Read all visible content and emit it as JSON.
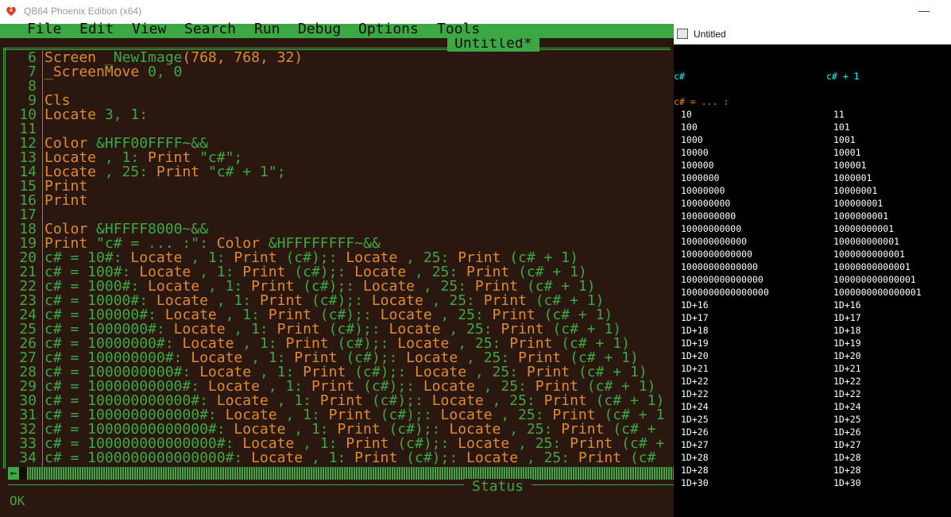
{
  "window": {
    "title": "QB64 Phoenix Edition (x64)",
    "minimize_glyph": "—"
  },
  "menu": [
    "File",
    "Edit",
    "View",
    "Search",
    "Run",
    "Debug",
    "Options",
    "Tools"
  ],
  "editor": {
    "tab_title": "Untitled*",
    "line_numbers": [
      "6",
      "7",
      "8",
      "9",
      "10",
      "11",
      "12",
      "13",
      "14",
      "15",
      "16",
      "17",
      "18",
      "19",
      "20",
      "21",
      "22",
      "23",
      "24",
      "25",
      "26",
      "27",
      "28",
      "29",
      "30",
      "31",
      "32",
      "33",
      "34"
    ],
    "lines": [
      [
        [
          "kw",
          "Screen "
        ],
        [
          "tx",
          "_NewImage"
        ],
        [
          "kw",
          "(768, 768, 32)"
        ]
      ],
      [
        [
          "kw",
          "_ScreenMove "
        ],
        [
          "tx",
          "0, 0"
        ]
      ],
      [],
      [
        [
          "kw",
          "Cls"
        ]
      ],
      [
        [
          "kw",
          "Locate "
        ],
        [
          "tx",
          "3, 1:"
        ]
      ],
      [],
      [
        [
          "kw",
          "Color "
        ],
        [
          "tx",
          "&HFF00FFFF~&&"
        ]
      ],
      [
        [
          "kw",
          "Locate "
        ],
        [
          "tx",
          ", 1: "
        ],
        [
          "kw",
          "Print "
        ],
        [
          "tx",
          "\"c#\";"
        ]
      ],
      [
        [
          "kw",
          "Locate "
        ],
        [
          "tx",
          ", 25: "
        ],
        [
          "kw",
          "Print "
        ],
        [
          "tx",
          "\"c# + 1\";"
        ]
      ],
      [
        [
          "kw",
          "Print"
        ]
      ],
      [
        [
          "kw",
          "Print"
        ]
      ],
      [],
      [
        [
          "kw",
          "Color "
        ],
        [
          "tx",
          "&HFFFF8000~&&"
        ]
      ],
      [
        [
          "kw",
          "Print "
        ],
        [
          "tx",
          "\"c# = ... :\": "
        ],
        [
          "kw",
          "Color "
        ],
        [
          "tx",
          "&HFFFFFFFF~&&"
        ]
      ],
      [
        [
          "tx",
          "c# = 10#: "
        ],
        [
          "kw",
          "Locate "
        ],
        [
          "tx",
          ", 1: "
        ],
        [
          "kw",
          "Print "
        ],
        [
          "tx",
          "(c#);: "
        ],
        [
          "kw",
          "Locate "
        ],
        [
          "tx",
          ", 25: "
        ],
        [
          "kw",
          "Print "
        ],
        [
          "tx",
          "(c# + 1)"
        ]
      ],
      [
        [
          "tx",
          "c# = 100#: "
        ],
        [
          "kw",
          "Locate "
        ],
        [
          "tx",
          ", 1: "
        ],
        [
          "kw",
          "Print "
        ],
        [
          "tx",
          "(c#);: "
        ],
        [
          "kw",
          "Locate "
        ],
        [
          "tx",
          ", 25: "
        ],
        [
          "kw",
          "Print "
        ],
        [
          "tx",
          "(c# + 1)"
        ]
      ],
      [
        [
          "tx",
          "c# = 1000#: "
        ],
        [
          "kw",
          "Locate "
        ],
        [
          "tx",
          ", 1: "
        ],
        [
          "kw",
          "Print "
        ],
        [
          "tx",
          "(c#);: "
        ],
        [
          "kw",
          "Locate "
        ],
        [
          "tx",
          ", 25: "
        ],
        [
          "kw",
          "Print "
        ],
        [
          "tx",
          "(c# + 1)"
        ]
      ],
      [
        [
          "tx",
          "c# = 10000#: "
        ],
        [
          "kw",
          "Locate "
        ],
        [
          "tx",
          ", 1: "
        ],
        [
          "kw",
          "Print "
        ],
        [
          "tx",
          "(c#);: "
        ],
        [
          "kw",
          "Locate "
        ],
        [
          "tx",
          ", 25: "
        ],
        [
          "kw",
          "Print "
        ],
        [
          "tx",
          "(c# + 1)"
        ]
      ],
      [
        [
          "tx",
          "c# = 100000#: "
        ],
        [
          "kw",
          "Locate "
        ],
        [
          "tx",
          ", 1: "
        ],
        [
          "kw",
          "Print "
        ],
        [
          "tx",
          "(c#);: "
        ],
        [
          "kw",
          "Locate "
        ],
        [
          "tx",
          ", 25: "
        ],
        [
          "kw",
          "Print "
        ],
        [
          "tx",
          "(c# + 1)"
        ]
      ],
      [
        [
          "tx",
          "c# = 1000000#: "
        ],
        [
          "kw",
          "Locate "
        ],
        [
          "tx",
          ", 1: "
        ],
        [
          "kw",
          "Print "
        ],
        [
          "tx",
          "(c#);: "
        ],
        [
          "kw",
          "Locate "
        ],
        [
          "tx",
          ", 25: "
        ],
        [
          "kw",
          "Print "
        ],
        [
          "tx",
          "(c# + 1)"
        ]
      ],
      [
        [
          "tx",
          "c# = 10000000#: "
        ],
        [
          "kw",
          "Locate "
        ],
        [
          "tx",
          ", 1: "
        ],
        [
          "kw",
          "Print "
        ],
        [
          "tx",
          "(c#);: "
        ],
        [
          "kw",
          "Locate "
        ],
        [
          "tx",
          ", 25: "
        ],
        [
          "kw",
          "Print "
        ],
        [
          "tx",
          "(c# + 1)"
        ]
      ],
      [
        [
          "tx",
          "c# = 100000000#: "
        ],
        [
          "kw",
          "Locate "
        ],
        [
          "tx",
          ", 1: "
        ],
        [
          "kw",
          "Print "
        ],
        [
          "tx",
          "(c#);: "
        ],
        [
          "kw",
          "Locate "
        ],
        [
          "tx",
          ", 25: "
        ],
        [
          "kw",
          "Print "
        ],
        [
          "tx",
          "(c# + 1)"
        ]
      ],
      [
        [
          "tx",
          "c# = 1000000000#: "
        ],
        [
          "kw",
          "Locate "
        ],
        [
          "tx",
          ", 1: "
        ],
        [
          "kw",
          "Print "
        ],
        [
          "tx",
          "(c#);: "
        ],
        [
          "kw",
          "Locate "
        ],
        [
          "tx",
          ", 25: "
        ],
        [
          "kw",
          "Print "
        ],
        [
          "tx",
          "(c# + 1)"
        ]
      ],
      [
        [
          "tx",
          "c# = 10000000000#: "
        ],
        [
          "kw",
          "Locate "
        ],
        [
          "tx",
          ", 1: "
        ],
        [
          "kw",
          "Print "
        ],
        [
          "tx",
          "(c#);: "
        ],
        [
          "kw",
          "Locate "
        ],
        [
          "tx",
          ", 25: "
        ],
        [
          "kw",
          "Print "
        ],
        [
          "tx",
          "(c# + 1)"
        ]
      ],
      [
        [
          "tx",
          "c# = 100000000000#: "
        ],
        [
          "kw",
          "Locate "
        ],
        [
          "tx",
          ", 1: "
        ],
        [
          "kw",
          "Print "
        ],
        [
          "tx",
          "(c#);: "
        ],
        [
          "kw",
          "Locate "
        ],
        [
          "tx",
          ", 25: "
        ],
        [
          "kw",
          "Print "
        ],
        [
          "tx",
          "(c# + 1)"
        ]
      ],
      [
        [
          "tx",
          "c# = 1000000000000#: "
        ],
        [
          "kw",
          "Locate "
        ],
        [
          "tx",
          ", 1: "
        ],
        [
          "kw",
          "Print "
        ],
        [
          "tx",
          "(c#);: "
        ],
        [
          "kw",
          "Locate "
        ],
        [
          "tx",
          ", 25: "
        ],
        [
          "kw",
          "Print "
        ],
        [
          "tx",
          "(c# + 1"
        ]
      ],
      [
        [
          "tx",
          "c# = 10000000000000#: "
        ],
        [
          "kw",
          "Locate "
        ],
        [
          "tx",
          ", 1: "
        ],
        [
          "kw",
          "Print "
        ],
        [
          "tx",
          "(c#);: "
        ],
        [
          "kw",
          "Locate "
        ],
        [
          "tx",
          ", 25: "
        ],
        [
          "kw",
          "Print "
        ],
        [
          "tx",
          "(c# +"
        ]
      ],
      [
        [
          "tx",
          "c# = 100000000000000#: "
        ],
        [
          "kw",
          "Locate "
        ],
        [
          "tx",
          ", 1: "
        ],
        [
          "kw",
          "Print "
        ],
        [
          "tx",
          "(c#);: "
        ],
        [
          "kw",
          "Locate "
        ],
        [
          "tx",
          ", 25: "
        ],
        [
          "kw",
          "Print "
        ],
        [
          "tx",
          "(c# +"
        ]
      ],
      [
        [
          "tx",
          "c# = 1000000000000000#: "
        ],
        [
          "kw",
          "Locate "
        ],
        [
          "tx",
          ", 1: "
        ],
        [
          "kw",
          "Print "
        ],
        [
          "tx",
          "(c#);: "
        ],
        [
          "kw",
          "Locate "
        ],
        [
          "tx",
          ", 25: "
        ],
        [
          "kw",
          "Print "
        ],
        [
          "tx",
          "(c#"
        ]
      ]
    ]
  },
  "hscroll_left_glyph": "←",
  "status": {
    "title": "Status",
    "message": "OK"
  },
  "output_window": {
    "title": "Untitled",
    "header_left": "c#",
    "header_right": "c# + 1",
    "subheader": "c# = ... :",
    "left_column": [
      "10",
      "100",
      "1000",
      "10000",
      "100000",
      "1000000",
      "10000000",
      "100000000",
      "1000000000",
      "10000000000",
      "100000000000",
      "1000000000000",
      "10000000000000",
      "100000000000000",
      "1000000000000000",
      "1D+16",
      "1D+17",
      "1D+18",
      "1D+19",
      "1D+20",
      "1D+21",
      "1D+22",
      "1D+22",
      "1D+24",
      "1D+25",
      "1D+26",
      "1D+27",
      "1D+28",
      "1D+28",
      "1D+30"
    ],
    "right_column": [
      "11",
      "101",
      "1001",
      "10001",
      "100001",
      "1000001",
      "10000001",
      "100000001",
      "1000000001",
      "10000000001",
      "100000000001",
      "1000000000001",
      "10000000000001",
      "100000000000001",
      "1000000000000001",
      "1D+16",
      "1D+17",
      "1D+18",
      "1D+19",
      "1D+20",
      "1D+21",
      "1D+22",
      "1D+22",
      "1D+24",
      "1D+25",
      "1D+26",
      "1D+27",
      "1D+28",
      "1D+28",
      "1D+30"
    ]
  },
  "colors": {
    "editor_bg": "#2a1810",
    "green": "#3ca844",
    "keyword_orange": "#e08a2c",
    "output_cyan": "#00ffff",
    "output_orange": "#ff8000"
  }
}
